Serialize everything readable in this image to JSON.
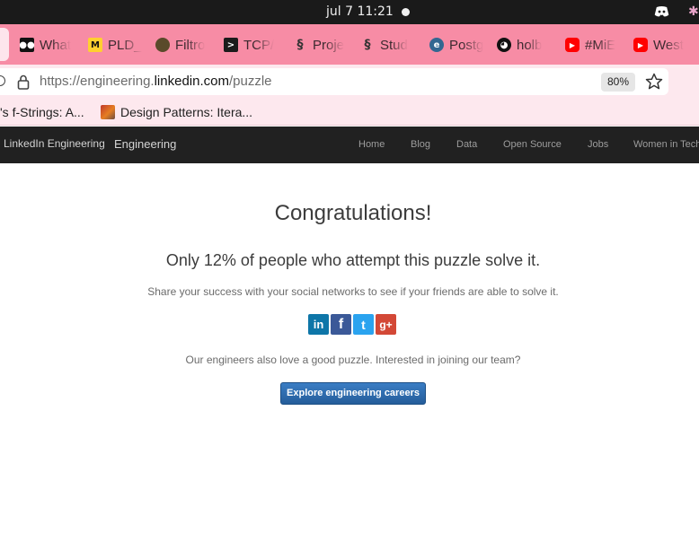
{
  "os": {
    "clock": "jul 7  11:21"
  },
  "tabs": [
    {
      "label": "What",
      "icon": "medium-icon",
      "icon_bg": "#111111"
    },
    {
      "label": "PLD_",
      "icon": "miro-icon",
      "icon_bg": "#ffd02f"
    },
    {
      "label": "Filtro",
      "icon": "avatar-icon",
      "icon_bg": "#5a4a2a"
    },
    {
      "label": "TCP/",
      "icon": "terminal-icon",
      "icon_bg": "#1b1b1b"
    },
    {
      "label": "Proje",
      "icon": "holberton-icon",
      "icon_bg": "#333333"
    },
    {
      "label": "Stud",
      "icon": "holberton-icon",
      "icon_bg": "#333333"
    },
    {
      "label": "Postg",
      "icon": "postgres-icon",
      "icon_bg": "#336791"
    },
    {
      "label": "holb",
      "icon": "github-icon",
      "icon_bg": "#111111"
    },
    {
      "label": "#MiE",
      "icon": "youtube-icon",
      "icon_bg": "#ff0000"
    },
    {
      "label": "West",
      "icon": "youtube-icon",
      "icon_bg": "#ff0000"
    }
  ],
  "address_bar": {
    "url_prefix": "https://engineering.",
    "url_domain": "linkedin.com",
    "url_path": "/puzzle",
    "zoom": "80%"
  },
  "bookmarks": [
    {
      "label": "'s f-Strings: A..."
    },
    {
      "label": "Design Patterns: Itera..."
    }
  ],
  "site_header": {
    "brand": "LinkedIn Engineering",
    "brand_sub": "Engineering",
    "nav": [
      "Home",
      "Blog",
      "Data",
      "Open Source",
      "Jobs",
      "Women in Tech"
    ]
  },
  "content": {
    "headline": "Congratulations!",
    "stat_line": "Only 12% of people who attempt this puzzle solve it.",
    "share_text": "Share your success with your social networks to see if your friends are able to solve it.",
    "social": [
      {
        "name": "linkedin-share",
        "glyph": "in",
        "color": "#0e76a8"
      },
      {
        "name": "facebook-share",
        "glyph": "f",
        "color": "#3b5998"
      },
      {
        "name": "twitter-share",
        "glyph": "t",
        "color": "#2aa3ef"
      },
      {
        "name": "googleplus-share",
        "glyph": "g+",
        "color": "#d34836"
      }
    ],
    "careers_text": "Our engineers also love a good puzzle. Interested in joining our team?",
    "careers_button": "Explore engineering careers"
  },
  "colors": {
    "tab_strip": "#f78ca5",
    "toolbar": "#fde8ee",
    "site_header_bg": "#212121",
    "button_blue": "#2b6cb0"
  }
}
